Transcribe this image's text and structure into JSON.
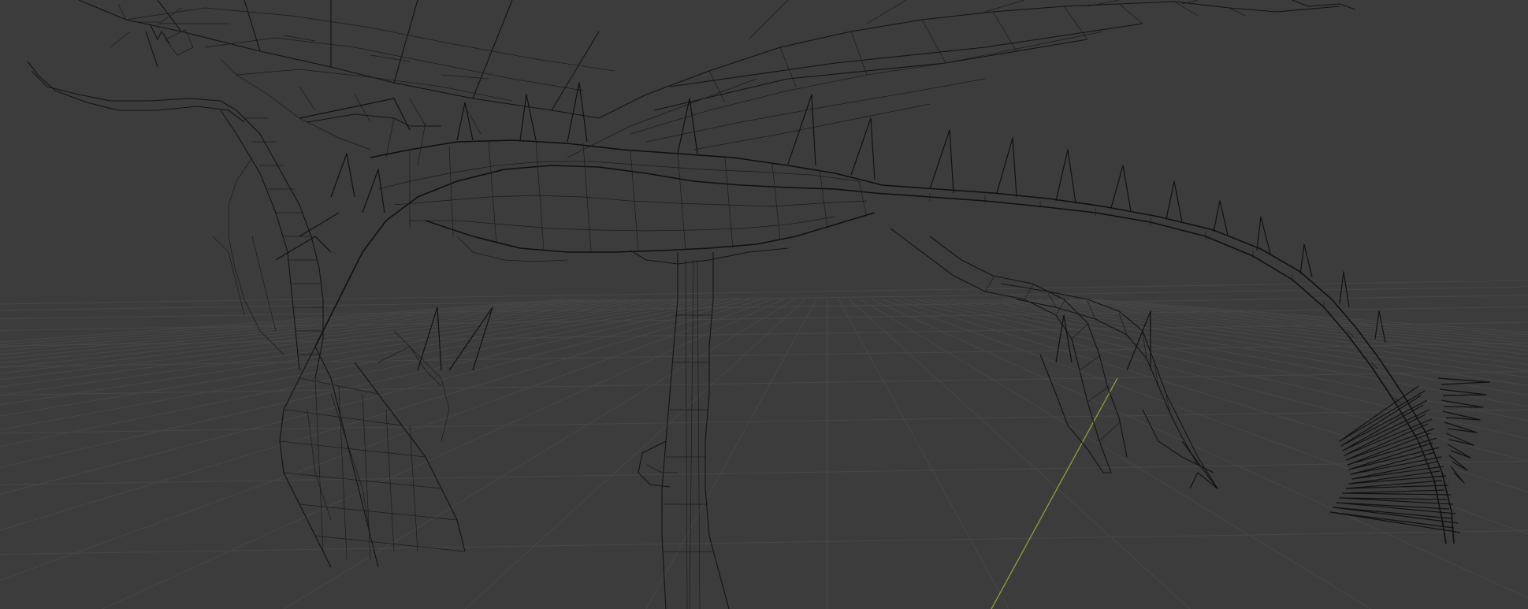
{
  "viewport": {
    "shading_mode": "wireframe",
    "view": "perspective",
    "subject": "dragon-mesh",
    "colors": {
      "background": "#3c3c3c",
      "grid": "#474747",
      "y_axis": "#8aa23c",
      "wire": "#151515"
    },
    "icons": {
      "grid": "floor-grid-icon",
      "axis": "y-axis-line-icon"
    }
  }
}
